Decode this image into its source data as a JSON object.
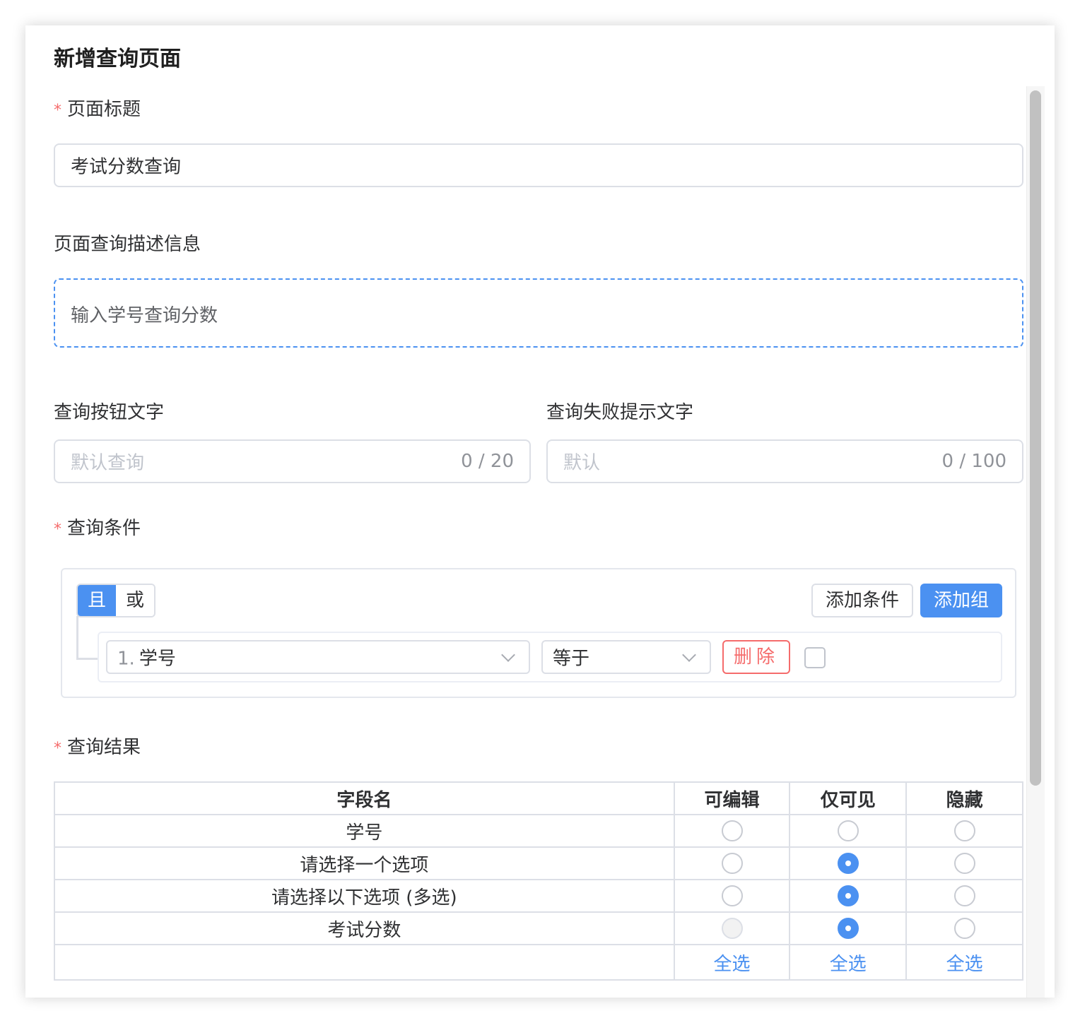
{
  "dialog": {
    "title": "新增查询页面"
  },
  "page_title": {
    "label": "页面标题",
    "required_mark": "*",
    "value": "考试分数查询"
  },
  "description": {
    "label": "页面查询描述信息",
    "value": "输入学号查询分数"
  },
  "query_button": {
    "label": "查询按钮文字",
    "placeholder": "默认查询",
    "counter": "0 / 20"
  },
  "fail_tip": {
    "label": "查询失败提示文字",
    "placeholder": "默认",
    "counter": "0 / 100"
  },
  "conditions": {
    "label": "查询条件",
    "required_mark": "*",
    "logic_and": "且",
    "logic_or": "或",
    "add_condition": "添加条件",
    "add_group": "添加组",
    "row": {
      "field_index": "1.",
      "field": "学号",
      "operator": "等于",
      "delete": "删除"
    }
  },
  "results": {
    "label": "查询结果",
    "required_mark": "*",
    "columns": [
      "字段名",
      "可编辑",
      "仅可见",
      "隐藏"
    ],
    "rows": [
      {
        "name": "学号",
        "selected": "none"
      },
      {
        "name": "请选择一个选项",
        "selected": "仅可见"
      },
      {
        "name": "请选择以下选项 (多选)",
        "selected": "仅可见"
      },
      {
        "name": "考试分数",
        "selected": "仅可见",
        "editable_disabled": true
      }
    ],
    "select_all": "全选"
  },
  "colors": {
    "primary": "#4b91f1",
    "danger": "#f56c6c",
    "border": "#dcdfe6"
  }
}
